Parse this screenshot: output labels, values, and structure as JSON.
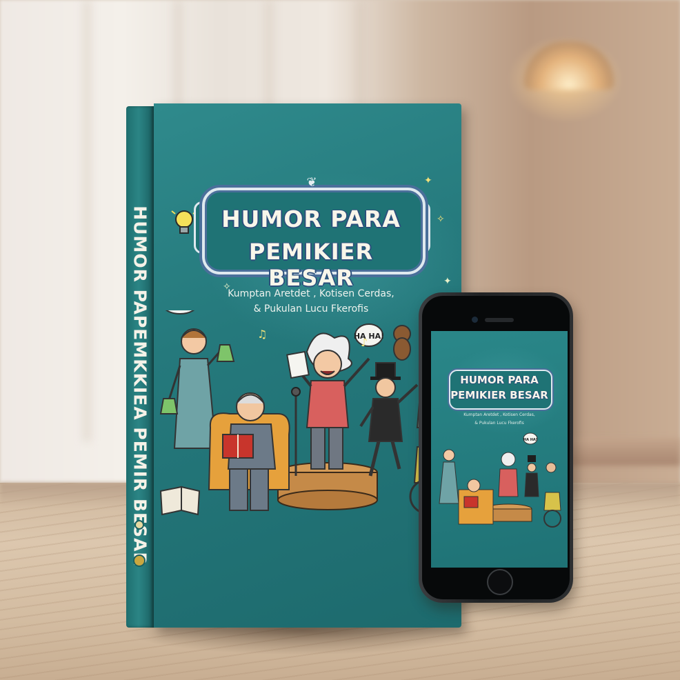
{
  "book": {
    "title_line_1": "HUMOR PARA",
    "title_line_2": "PEMIKIER BESAR",
    "subtitle_line_1": "Kumptan Aretdet , Kotisen Cerdas,",
    "subtitle_line_2": "& Pukulan Lucu Fkerofis",
    "spine_text": "HUMOR PAPEMKKIEA PEMIR BESAR",
    "speech_bubble": "HA HA!",
    "cover_color": "#26797c"
  },
  "phone": {
    "title_line_1": "HUMOR PARA",
    "title_line_2": "PEMIKIER BESAR",
    "subtitle_line_1": "Kumptan Aretdet , Kotisen Cerdas,",
    "subtitle_line_2": "& Pukulan Lucu Fkerofis",
    "speech_bubble": "HA HA!"
  }
}
